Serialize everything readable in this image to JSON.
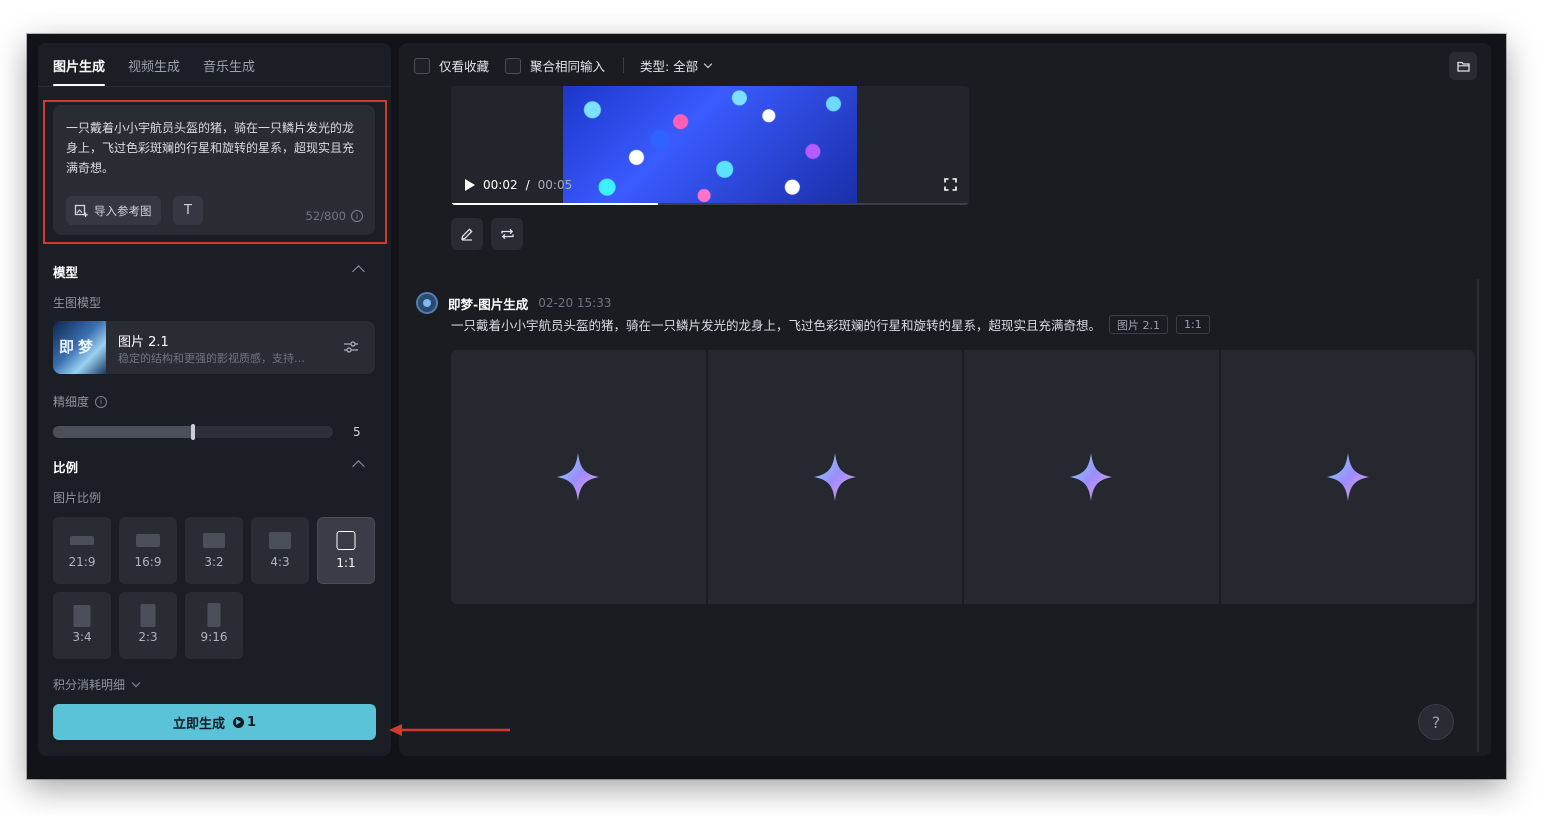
{
  "tabs": [
    {
      "label": "图片生成",
      "active": true
    },
    {
      "label": "视频生成",
      "active": false
    },
    {
      "label": "音乐生成",
      "active": false
    }
  ],
  "prompt": {
    "text": "一只戴着小小宇航员头盔的猪，骑在一只鳞片发光的龙身上，飞过色彩斑斓的行星和旋转的星系，超现实且充满奇想。",
    "import_ref_label": "导入参考图",
    "text_tool_label": "T",
    "counter": "52/800"
  },
  "model_section": {
    "title": "模型",
    "sub_label": "生图模型",
    "model_name": "图片 2.1",
    "model_desc": "稳定的结构和更强的影视质感，支持…",
    "thumb_text": "即梦"
  },
  "precision": {
    "label": "精细度",
    "value": "5",
    "fill_fraction": 0.5
  },
  "ratio_section": {
    "title": "比例",
    "sub_label": "图片比例",
    "options": [
      {
        "label": "21:9",
        "selected": false
      },
      {
        "label": "16:9",
        "selected": false
      },
      {
        "label": "3:2",
        "selected": false
      },
      {
        "label": "4:3",
        "selected": false
      },
      {
        "label": "1:1",
        "selected": true
      },
      {
        "label": "3:4",
        "selected": false
      },
      {
        "label": "2:3",
        "selected": false
      },
      {
        "label": "9:16",
        "selected": false
      }
    ]
  },
  "credits": {
    "label": "积分消耗明细"
  },
  "generate": {
    "label": "立即生成",
    "cost": "1",
    "color": "#5ac3d8"
  },
  "toolbar": {
    "only_favorites": "仅看收藏",
    "merge_same": "聚合相同输入",
    "type_filter": "类型: 全部"
  },
  "video": {
    "current_time": "00:02",
    "separator": "/",
    "duration": "00:05",
    "progress_fraction": 0.4
  },
  "generation": {
    "name": "即梦-图片生成",
    "time": "02-20  15:33",
    "prompt": "一只戴着小小宇航员头盔的猪，骑在一只鳞片发光的龙身上，飞过色彩斑斓的行星和旋转的星系，超现实且充满奇想。",
    "tags": [
      "图片 2.1",
      "1:1"
    ],
    "placeholder_count": 4
  },
  "help": {
    "label": "?"
  },
  "annotation": {
    "highlight_color": "#d23a2c"
  }
}
